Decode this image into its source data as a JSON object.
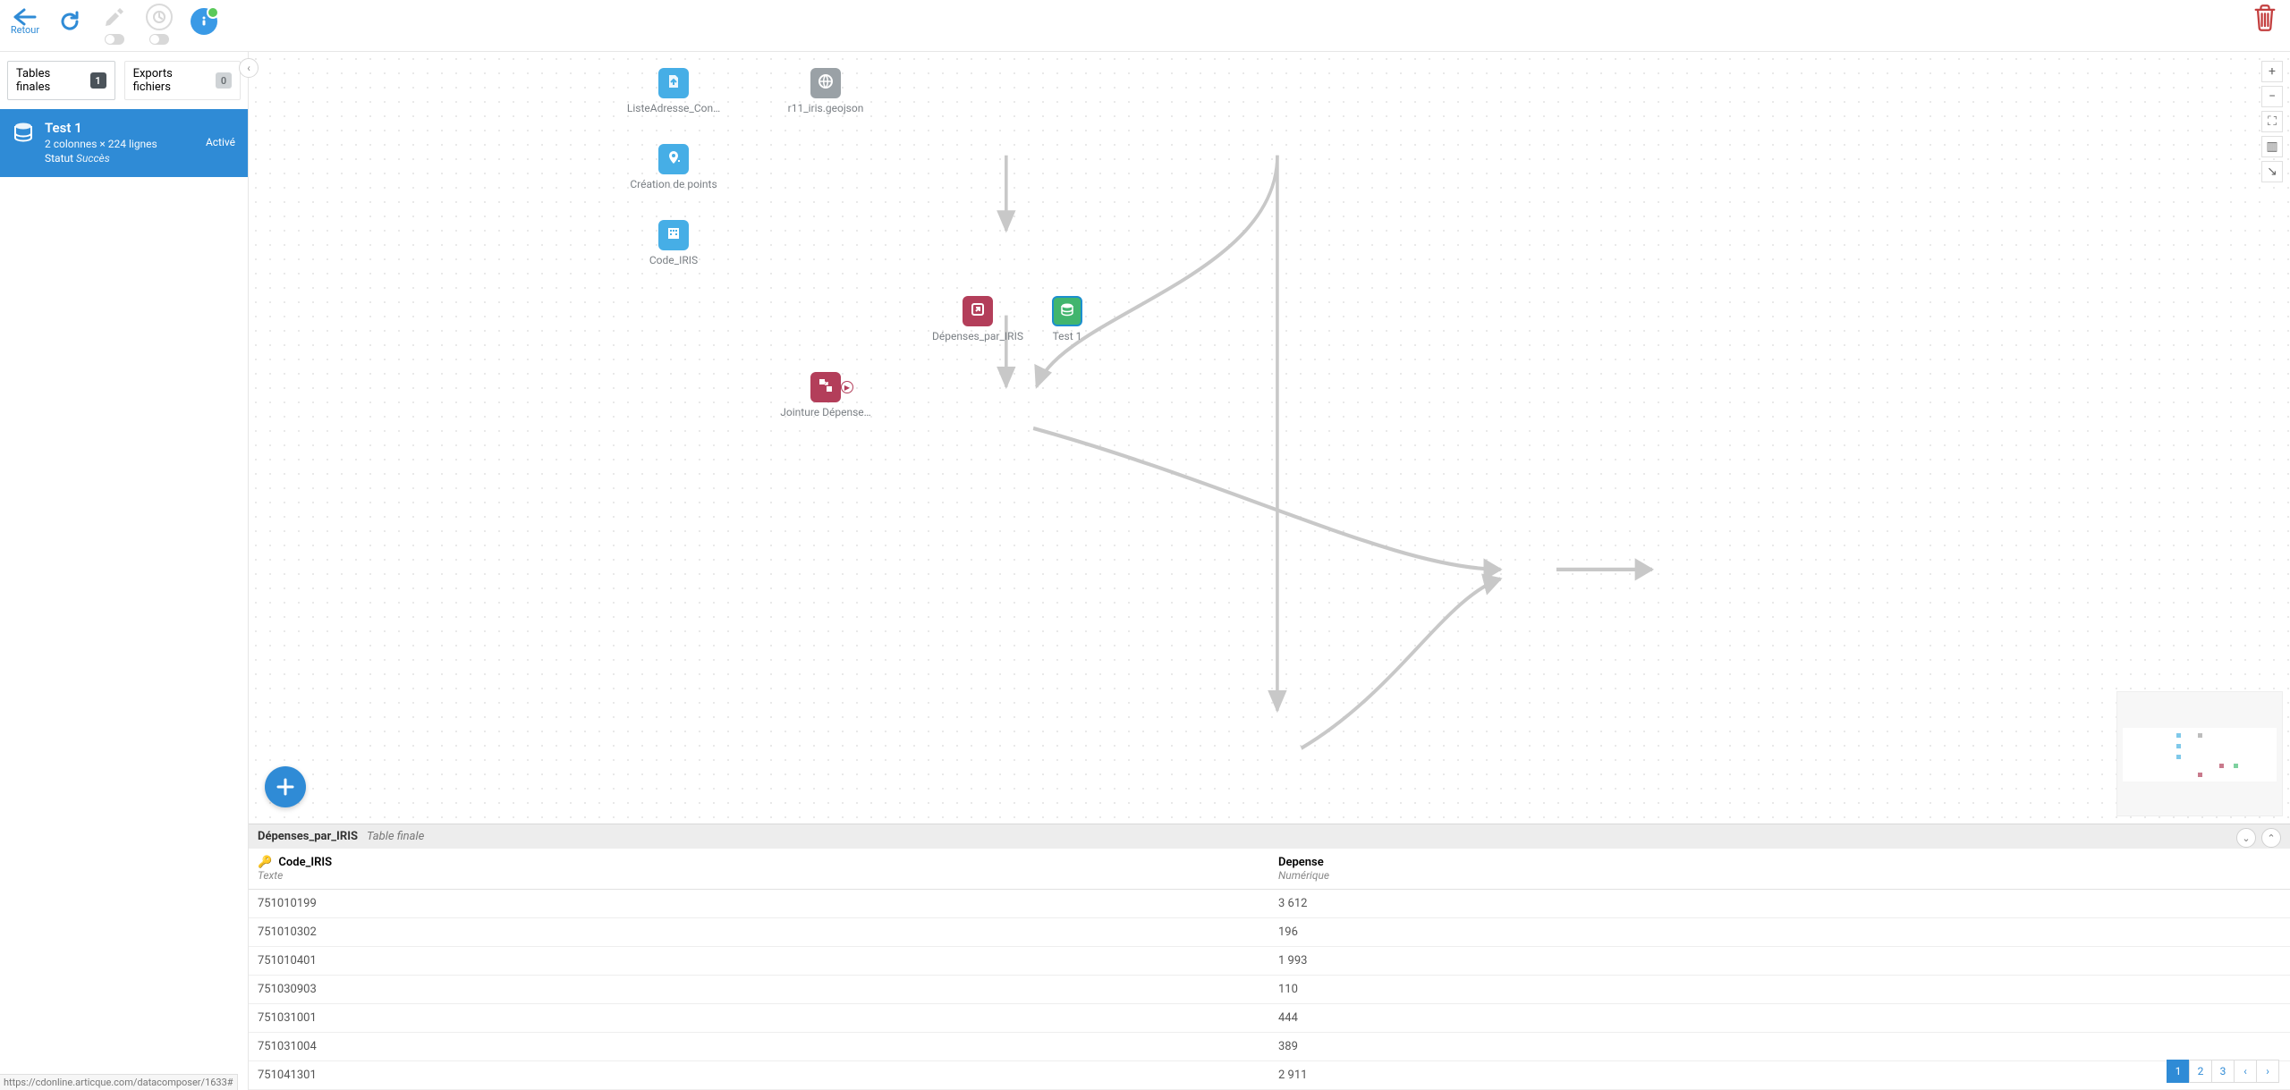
{
  "toolbar": {
    "back_label": "Retour"
  },
  "sidebar": {
    "tabs": [
      {
        "label": "Tables finales",
        "count": "1"
      },
      {
        "label": "Exports fichiers",
        "count": "0"
      }
    ],
    "item": {
      "title": "Test 1",
      "dims": "2 colonnes × 224 lignes",
      "status_label": "Statut",
      "status_value": "Succès",
      "right": "Activé"
    }
  },
  "canvas": {
    "nodes": {
      "listeadresse": {
        "label": "ListeAdresse_Con…"
      },
      "r11": {
        "label": "r11_iris.geojson"
      },
      "creation": {
        "label": "Création de points"
      },
      "codeiris": {
        "label": "Code_IRIS"
      },
      "jointure": {
        "label": "Jointure Dépense…"
      },
      "depenses": {
        "label": "Dépenses_par_IRIS"
      },
      "test": {
        "label": "Test 1"
      }
    }
  },
  "panel": {
    "title": "Dépenses_par_IRIS",
    "subtitle": "Table finale",
    "columns": [
      {
        "name": "Code_IRIS",
        "type": "Texte",
        "is_key": true
      },
      {
        "name": "Depense",
        "type": "Numérique",
        "is_key": false
      }
    ],
    "rows": [
      {
        "code": "751010199",
        "dep": "3 612"
      },
      {
        "code": "751010302",
        "dep": "196"
      },
      {
        "code": "751010401",
        "dep": "1 993"
      },
      {
        "code": "751030903",
        "dep": "110"
      },
      {
        "code": "751031001",
        "dep": "444"
      },
      {
        "code": "751031004",
        "dep": "389"
      },
      {
        "code": "751041301",
        "dep": "2 911"
      }
    ],
    "pages": [
      "1",
      "2",
      "3"
    ],
    "active_page": "1"
  },
  "statusbar": {
    "url": "https://cdonline.articque.com/datacomposer/1633#"
  },
  "chart_data": {
    "type": "table",
    "title": "Dépenses_par_IRIS",
    "columns": [
      "Code_IRIS",
      "Depense"
    ],
    "column_types": [
      "Texte",
      "Numérique"
    ],
    "rows": [
      [
        "751010199",
        3612
      ],
      [
        "751010302",
        196
      ],
      [
        "751010401",
        1993
      ],
      [
        "751030903",
        110
      ],
      [
        "751031001",
        444
      ],
      [
        "751031004",
        389
      ],
      [
        "751041301",
        2911
      ]
    ]
  }
}
